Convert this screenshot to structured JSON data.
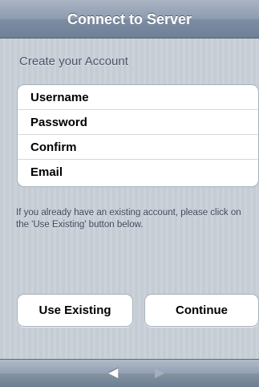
{
  "navbar": {
    "title": "Connect to Server"
  },
  "form": {
    "header": "Create your Account",
    "fields": [
      {
        "label": "Username"
      },
      {
        "label": "Password"
      },
      {
        "label": "Confirm"
      },
      {
        "label": "Email"
      }
    ]
  },
  "footnote": "If you already have an existing account, please click on the 'Use Existing' button below.",
  "buttons": {
    "use_existing": "Use Existing",
    "continue": "Continue"
  },
  "toolbar": {
    "back_glyph": "◀",
    "forward_glyph": "▶",
    "back_icon": "back-arrow-icon",
    "forward_icon": "forward-arrow-icon",
    "forward_enabled": false
  },
  "colors": {
    "navbar_gradient_top": "#aab4c3",
    "navbar_gradient_bottom": "#6f7f97",
    "background_stripe_a": "#c5ccd4",
    "background_stripe_b": "#cbd2da",
    "header_text": "#4c566c",
    "forward_disabled": "#a4afbf"
  }
}
